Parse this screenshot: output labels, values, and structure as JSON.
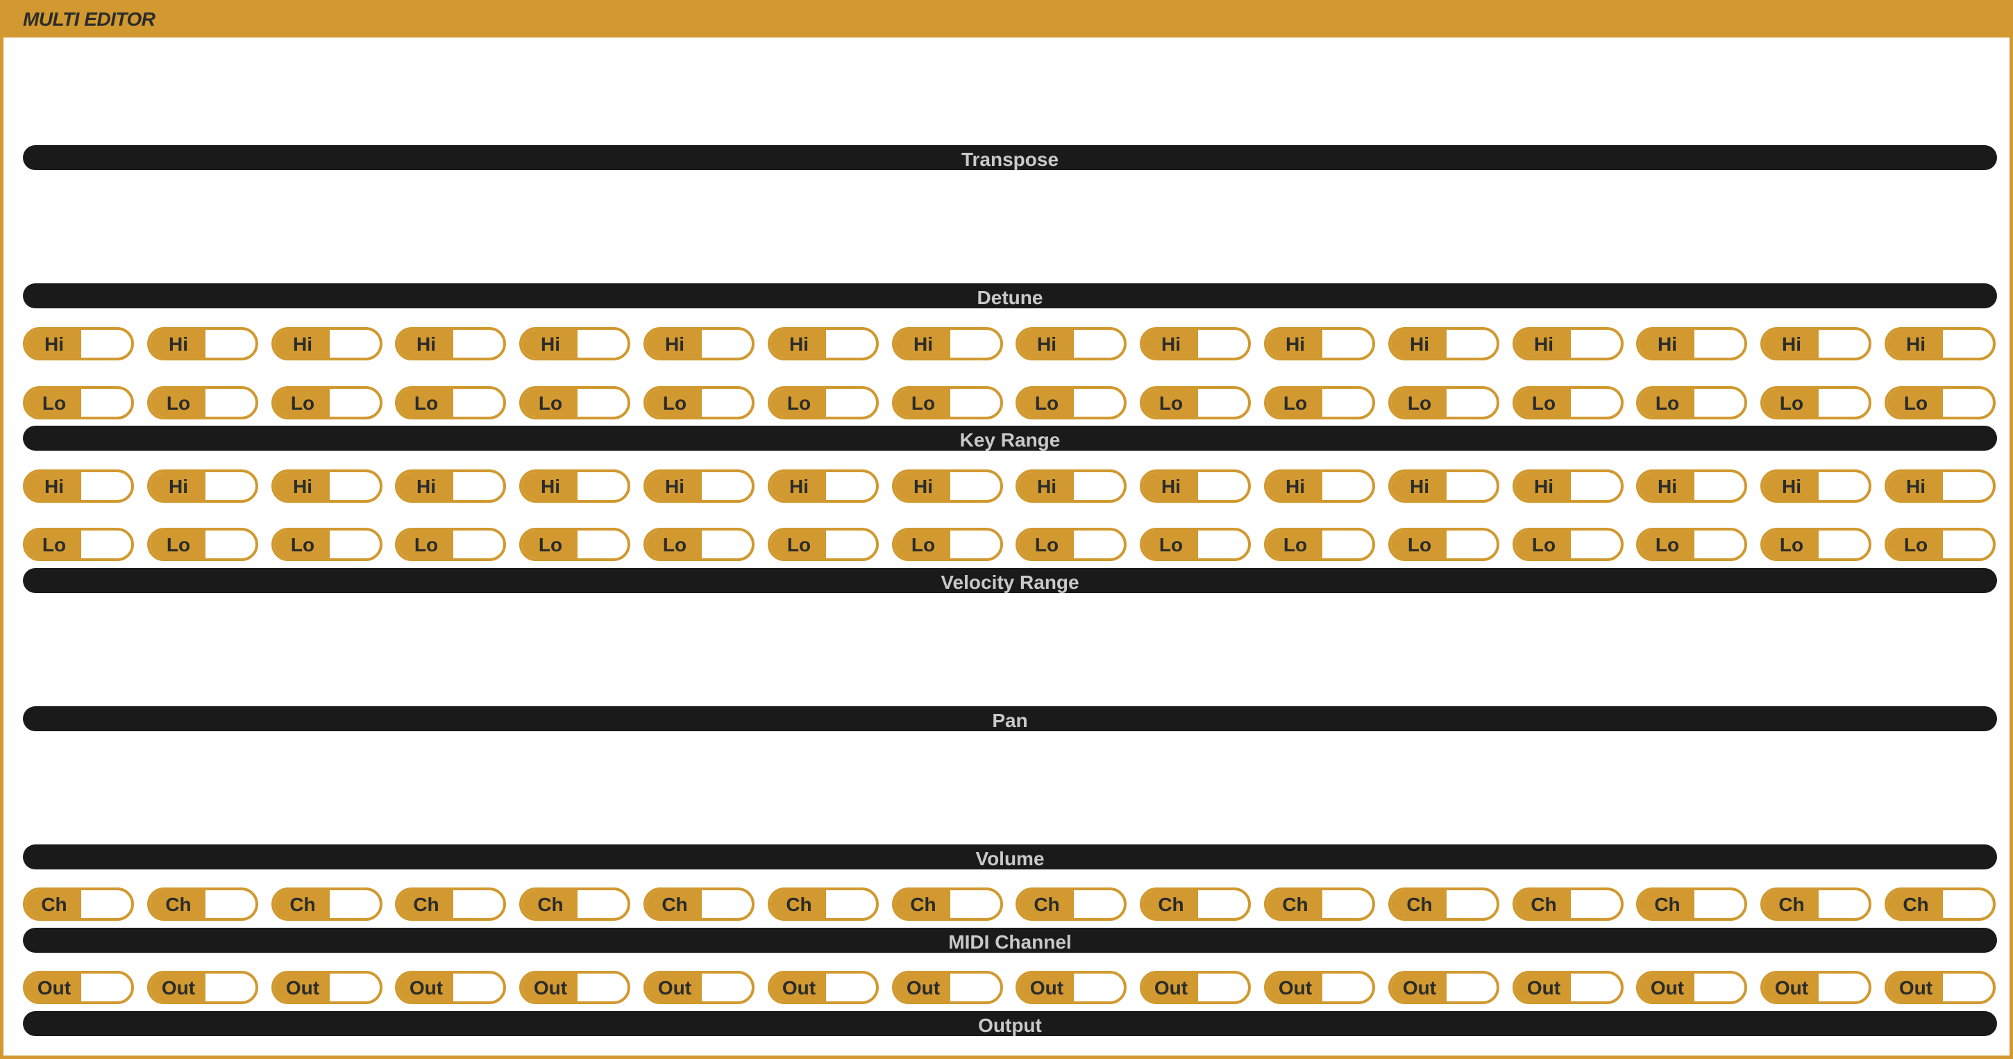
{
  "window": {
    "title": "MULTI EDITOR"
  },
  "colors": {
    "accent": "#D1992F",
    "bar": "#1a1a1a",
    "bar_text": "#c9c9c9",
    "tag_text": "#2b2b2b"
  },
  "channel_count": 16,
  "sections": {
    "transpose": {
      "label": "Transpose"
    },
    "detune": {
      "label": "Detune"
    },
    "key_range": {
      "label": "Key Range",
      "hi_label": "Hi",
      "lo_label": "Lo"
    },
    "velocity_range": {
      "label": "Velocity Range",
      "hi_label": "Hi",
      "lo_label": "Lo"
    },
    "pan": {
      "label": "Pan"
    },
    "volume": {
      "label": "Volume"
    },
    "midi_channel": {
      "label": "MIDI Channel",
      "field_label": "Ch"
    },
    "output": {
      "label": "Output",
      "field_label": "Out"
    }
  }
}
